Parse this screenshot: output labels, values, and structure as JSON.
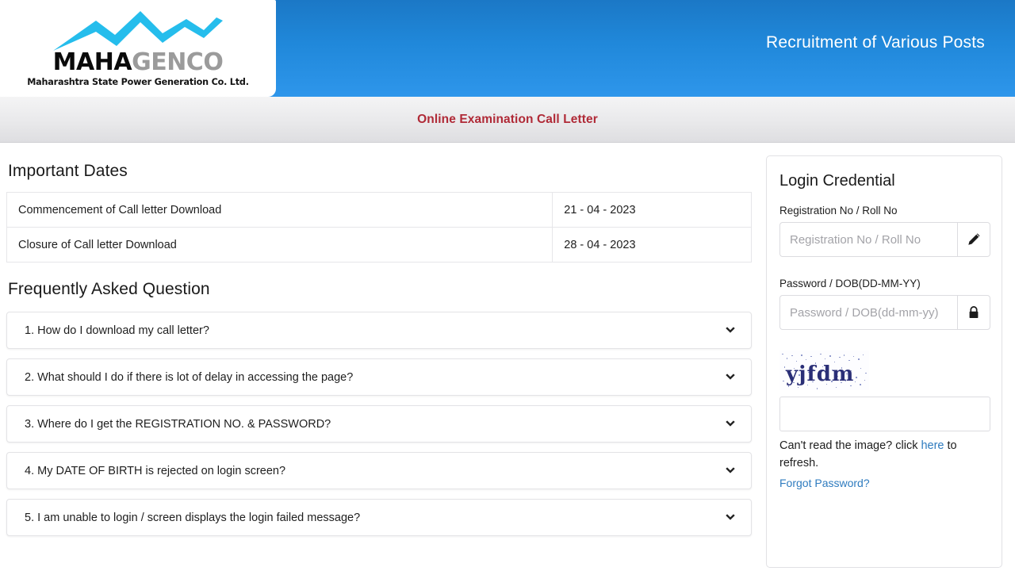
{
  "header": {
    "logo": {
      "word_primary": "MAHA",
      "word_secondary": "GENCO",
      "tagline": "Maharashtra State Power Generation Co. Ltd.",
      "mark_name": "lightning-mountain-mark"
    },
    "title": "Recruitment of Various Posts",
    "gradient_from": "#1b78c6",
    "gradient_to": "#2e96eb"
  },
  "subbanner": {
    "text": "Online Examination Call Letter",
    "text_color": "#b02a37"
  },
  "important_dates": {
    "title": "Important Dates",
    "rows": [
      {
        "label": "Commencement of Call letter Download",
        "value": "21 - 04 - 2023"
      },
      {
        "label": "Closure of Call letter Download",
        "value": "28 - 04 - 2023"
      }
    ]
  },
  "faq": {
    "title": "Frequently Asked Question",
    "items": [
      {
        "question": "1. How do I download my call letter?"
      },
      {
        "question": "2. What should I do if there is lot of delay in accessing the page?"
      },
      {
        "question": "3. Where do I get the REGISTRATION NO. & PASSWORD?"
      },
      {
        "question": "4. My DATE OF BIRTH is rejected on login screen?"
      },
      {
        "question": "5. I am unable to login / screen displays the login failed message?"
      }
    ],
    "expand_icon": "chevron-down-icon"
  },
  "login": {
    "heading": "Login Credential",
    "registration": {
      "label": "Registration No / Roll No",
      "placeholder": "Registration No / Roll No",
      "value": "",
      "icon": "pencil-icon"
    },
    "password": {
      "label": "Password / DOB(DD-MM-YY)",
      "placeholder": "Password / DOB(dd-mm-yy)",
      "value": "",
      "icon": "lock-icon"
    },
    "captcha": {
      "text": "yjfdm",
      "color": "#2b2f77",
      "input_value": "",
      "input_placeholder": ""
    },
    "refresh": {
      "prefix": "Can't read the image? click ",
      "link": "here",
      "suffix": " to refresh."
    },
    "forgot_password": "Forgot Password?",
    "link_color": "#2e7bbf"
  }
}
